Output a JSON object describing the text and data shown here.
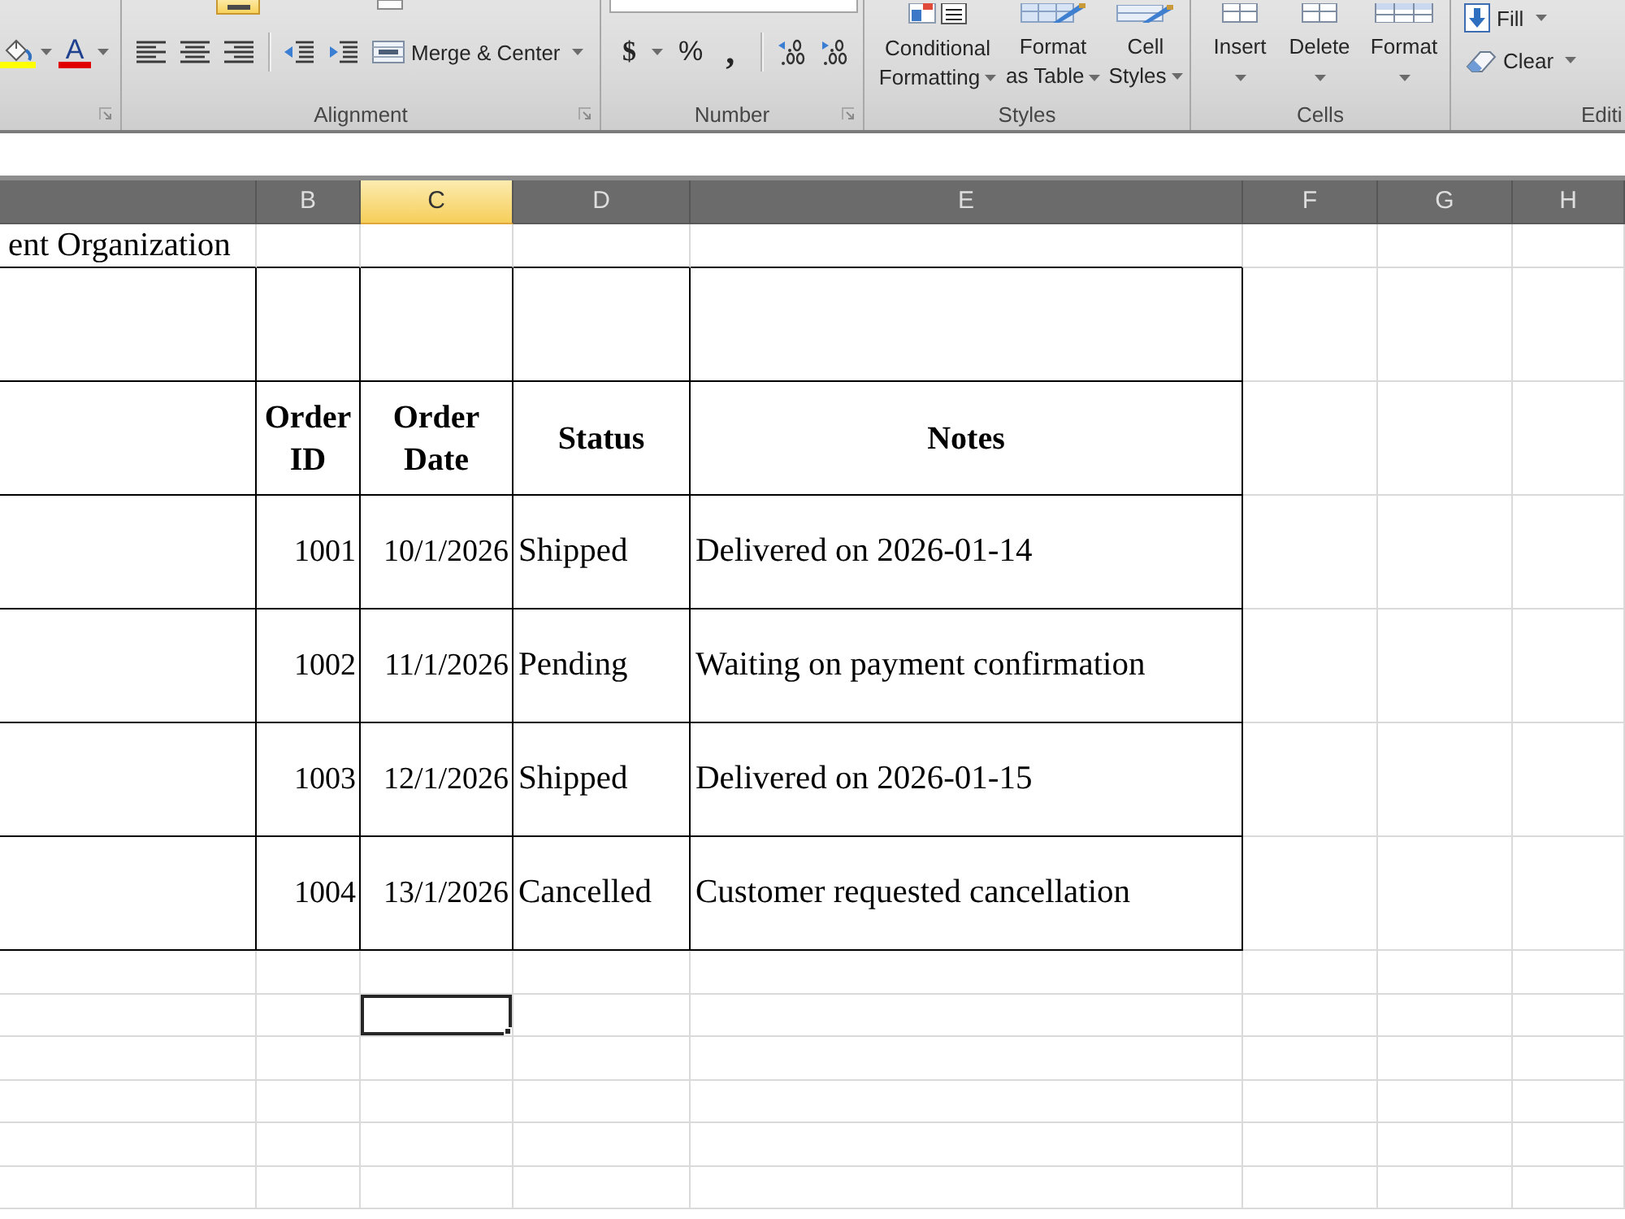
{
  "ribbon": {
    "groups": [
      {
        "kind": "font",
        "font_color_glyph": "A"
      },
      {
        "kind": "alignment",
        "label": "Alignment",
        "vertical_align": {
          "selected": true
        },
        "merge_button": "Merge & Center"
      },
      {
        "kind": "number",
        "label": "Number",
        "symbol_buttons": [
          {
            "kind": "currency",
            "label": "$"
          },
          {
            "kind": "percent",
            "label": "%"
          },
          {
            "kind": "comma",
            "label": ","
          }
        ]
      },
      {
        "kind": "styles",
        "label": "Styles",
        "buttons": [
          {
            "kind": "conditional",
            "lines": [
              "Conditional",
              "Formatting"
            ]
          },
          {
            "kind": "table",
            "lines": [
              "Format",
              "as Table"
            ]
          },
          {
            "kind": "cellstyle",
            "lines": [
              "Cell",
              "Styles"
            ]
          }
        ]
      },
      {
        "kind": "cells",
        "label": "Cells",
        "buttons": [
          {
            "kind": "insert",
            "label": "Insert"
          },
          {
            "kind": "delete",
            "label": "Delete"
          },
          {
            "kind": "format",
            "label": "Format"
          }
        ]
      },
      {
        "kind": "editing",
        "label": "Editi",
        "buttons": [
          {
            "kind": "fill",
            "label": "Fill"
          },
          {
            "kind": "clear",
            "label": "Clear"
          }
        ]
      }
    ]
  },
  "sheet": {
    "columns": [
      {
        "selected": false
      },
      {
        "label": "B",
        "selected": false
      },
      {
        "label": "C",
        "selected": true
      },
      {
        "label": "D",
        "selected": false
      },
      {
        "label": "E",
        "selected": false
      },
      {
        "label": "F",
        "selected": false
      },
      {
        "label": "G",
        "selected": false
      },
      {
        "label": "H",
        "selected": false
      }
    ],
    "title": "ent Organization",
    "table": {
      "headers": [
        "Order ID",
        "Order Date",
        "Status",
        "Notes"
      ],
      "rows": [
        {
          "order_id": "1001",
          "order_date": "10/1/2026",
          "status": "Shipped",
          "notes": "Delivered on 2026-01-14"
        },
        {
          "order_id": "1002",
          "order_date": "11/1/2026",
          "status": "Pending",
          "notes": "Waiting on payment confirmation"
        },
        {
          "order_id": "1003",
          "order_date": "12/1/2026",
          "status": "Shipped",
          "notes": "Delivered on 2026-01-15"
        },
        {
          "order_id": "1004",
          "order_date": "13/1/2026",
          "status": "Cancelled",
          "notes": "Customer requested cancellation"
        }
      ]
    },
    "blank_rows": [
      {
        "selected": false
      },
      {
        "selected": true
      },
      {
        "selected": false
      },
      {
        "selected": false
      },
      {
        "selected": false
      },
      {
        "selected": false
      }
    ]
  }
}
